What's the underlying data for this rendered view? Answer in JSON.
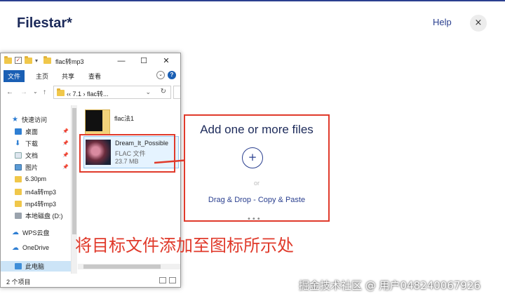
{
  "app": {
    "logo": "Filestar*",
    "help_label": "Help",
    "close_label": "×"
  },
  "explorer": {
    "title": "flac转mp3",
    "window_buttons": {
      "minimize": "—",
      "maximize": "☐",
      "close": "✕"
    },
    "ribbon_tabs": [
      "文件",
      "主页",
      "共享",
      "查看"
    ],
    "address": "‹‹  7.1  ›  flac转...",
    "nav_items": [
      {
        "label": "快速访问",
        "pinned": false
      },
      {
        "label": "桌面",
        "pinned": true
      },
      {
        "label": "下载",
        "pinned": true
      },
      {
        "label": "文档",
        "pinned": true
      },
      {
        "label": "图片",
        "pinned": true
      },
      {
        "label": "6.30pm",
        "pinned": false
      },
      {
        "label": "m4a转mp3",
        "pinned": false
      },
      {
        "label": "mp4转mp3",
        "pinned": false
      },
      {
        "label": "本地磁盘 (D:)",
        "pinned": false
      },
      {
        "label": "WPS云盘",
        "pinned": false
      },
      {
        "label": "OneDrive",
        "pinned": false
      },
      {
        "label": "此电脑",
        "pinned": false
      }
    ],
    "files": [
      {
        "name": "flac法1",
        "type": "",
        "size": ""
      },
      {
        "name": "Dream_It_Possible",
        "type": "FLAC 文件",
        "size": "23.7 MB"
      }
    ],
    "status_count": "2 个项目"
  },
  "dropzone": {
    "title": "Add one or more files",
    "plus": "+",
    "or": "or",
    "drag_text": "Drag & Drop - Copy & Paste",
    "dots": "•••"
  },
  "annotation": {
    "instruction": "将目标文件添加至图标所示处",
    "color": "#e03a2b"
  },
  "watermark": "掘金技术社区 @ 用户048240067926"
}
